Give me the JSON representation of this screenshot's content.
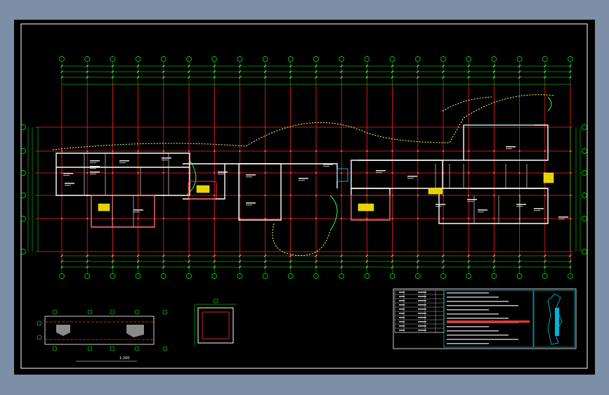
{
  "window": {
    "background": "#7d8fa6",
    "viewport_background": "#000000"
  },
  "drawing": {
    "grid_line_color": "#ff1f1f",
    "dimension_color": "#00ff00",
    "wall_color": "#ffffff",
    "highlight_color": "#ffff00",
    "grid_bubble_count_top": 21,
    "grid_bubble_count_side": 5
  },
  "sheet": {
    "plan_title": "",
    "site_plan_label": "",
    "site_plan_scale": "1:200"
  },
  "title_block": {
    "present": true
  }
}
